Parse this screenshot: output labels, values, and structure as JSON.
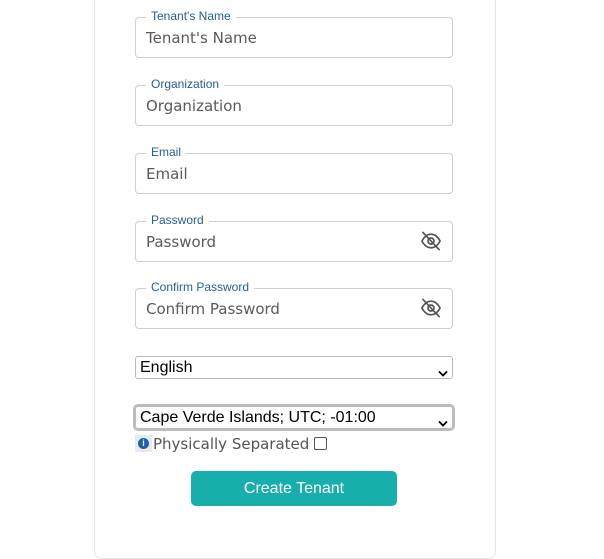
{
  "form": {
    "tenant_name": {
      "label": "Tenant's Name",
      "placeholder": "Tenant's Name"
    },
    "organization": {
      "label": "Organization",
      "placeholder": "Organization"
    },
    "email": {
      "label": "Email",
      "placeholder": "Email"
    },
    "password": {
      "label": "Password",
      "placeholder": "Password",
      "toggle_icon": "eye-off-icon"
    },
    "confirm_password": {
      "label": "Confirm Password",
      "placeholder": "Confirm Password",
      "toggle_icon": "eye-off-icon"
    },
    "language": {
      "selected": "English"
    },
    "timezone": {
      "selected": "Cape Verde Islands; UTC; -01:00"
    },
    "physically_separated": {
      "label": "Physically Separated",
      "info_icon": "info-icon",
      "checked": false
    },
    "submit_label": "Create Tenant"
  },
  "colors": {
    "accent": "#18aeab",
    "label": "#1f5f97",
    "info": "#1a5fb4"
  }
}
